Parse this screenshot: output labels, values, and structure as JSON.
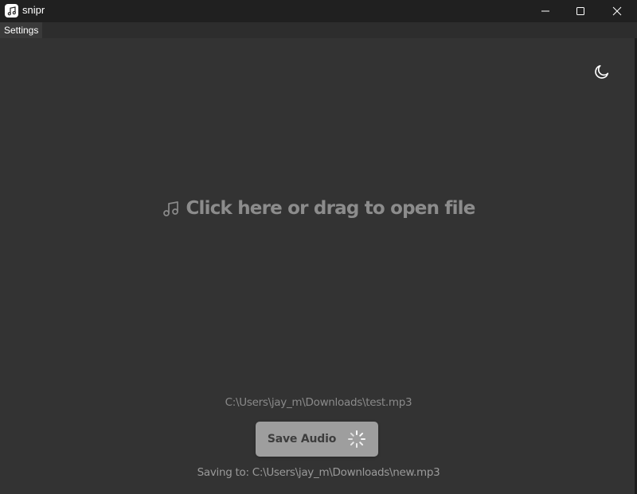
{
  "window": {
    "title": "snipr",
    "app_icon": "music-note-icon",
    "controls": [
      "minimize-icon",
      "maximize-icon",
      "close-icon"
    ]
  },
  "menu": {
    "items": [
      {
        "label": "Settings"
      }
    ]
  },
  "theme_toggle": {
    "icon": "moon-icon"
  },
  "dropzone": {
    "icon": "music-note-icon",
    "label": "Click here or drag to open file"
  },
  "file": {
    "path": "C:\\Users\\jay_m\\Downloads\\test.mp3"
  },
  "save": {
    "label": "Save Audio",
    "status_icon": "spinner-icon",
    "saving_to": "Saving to: C:\\Users\\jay_m\\Downloads\\new.mp3"
  },
  "colors": {
    "background": "#333333",
    "titlebar": "#202020",
    "button": "#9e9e9e",
    "muted_text": "#8a8a8a"
  }
}
